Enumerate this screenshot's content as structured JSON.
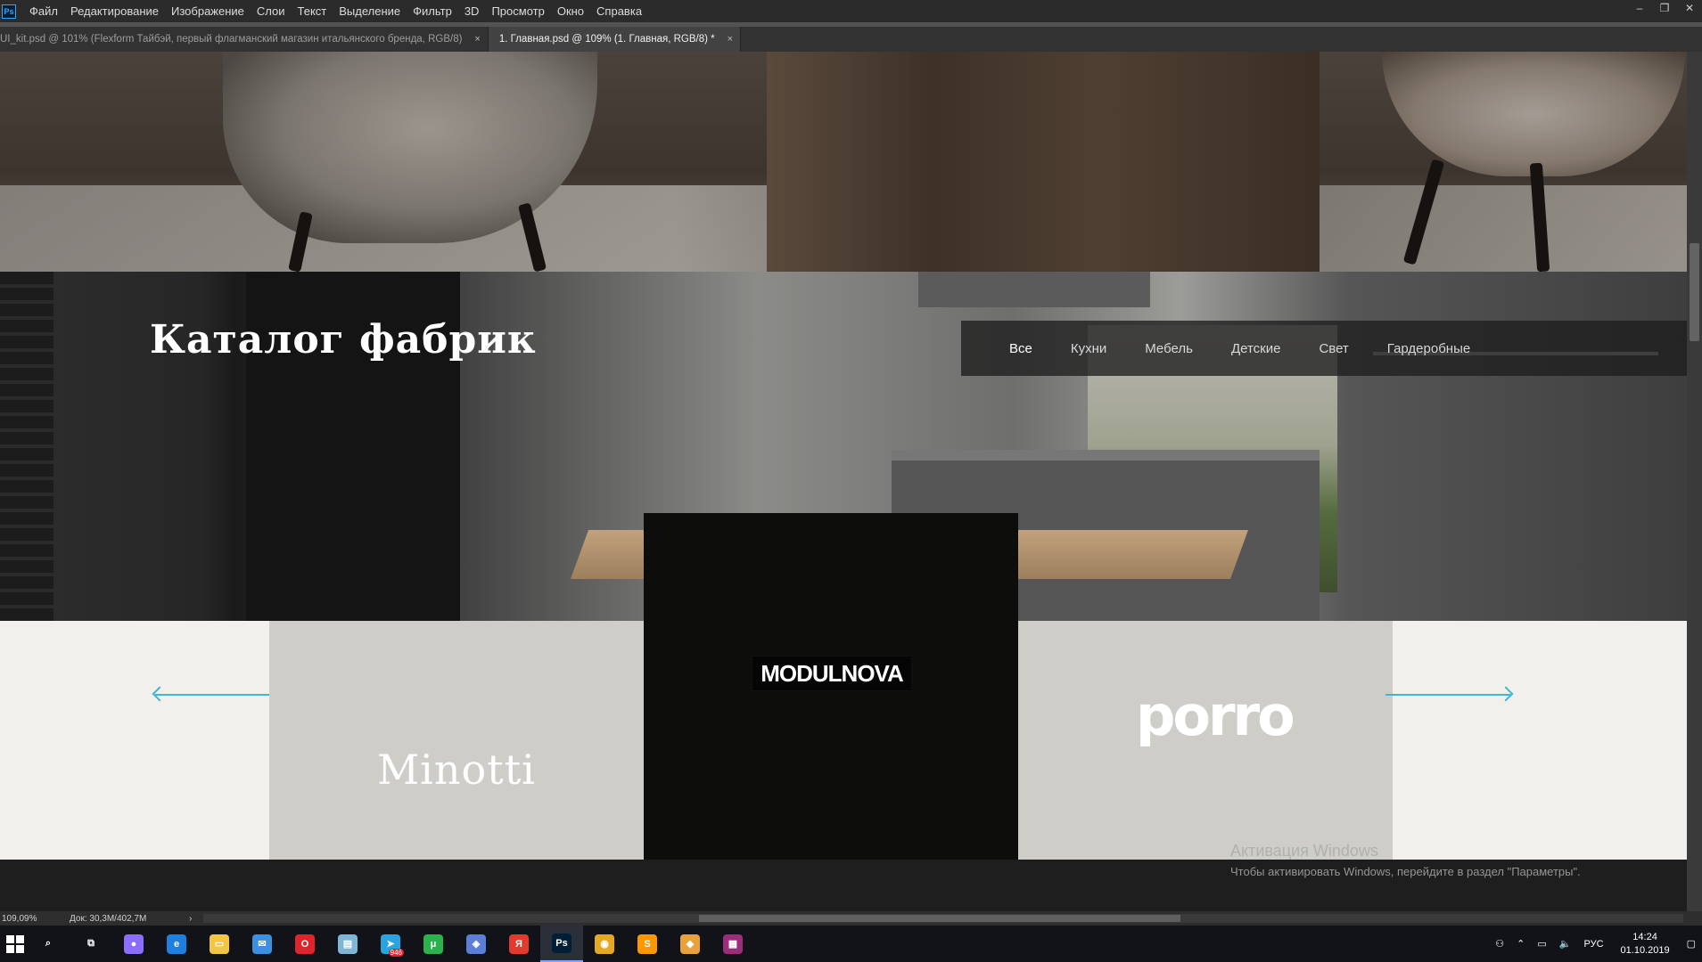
{
  "app": {
    "logo": "Ps"
  },
  "menu": [
    "Файл",
    "Редактирование",
    "Изображение",
    "Слои",
    "Текст",
    "Выделение",
    "Фильтр",
    "3D",
    "Просмотр",
    "Окно",
    "Справка"
  ],
  "window_controls": {
    "minimize": "–",
    "restore": "❐",
    "close": "✕"
  },
  "tabs": [
    {
      "label": "UI_kit.psd @ 101% (Flexform Тайбэй, первый флагманский магазин итальянского бренда, RGB/8)",
      "close": "×"
    },
    {
      "label": "1. Главная.psd @ 109% (1. Главная, RGB/8) *",
      "close": "×"
    }
  ],
  "page": {
    "heading": "Каталог фабрик",
    "filters": [
      "Все",
      "Кухни",
      "Мебель",
      "Детские",
      "Свет",
      "Гардеробные"
    ],
    "brands": {
      "minotti": "Minotti",
      "modulnova": "MODULNOVA",
      "porro": "porro"
    }
  },
  "watermark": {
    "title": "Активация Windows",
    "subtitle": "Чтобы активировать Windows, перейдите в раздел \"Параметры\"."
  },
  "status": {
    "zoom": "109,09%",
    "doc": "Док: 30,3M/402,7M",
    "arrow_right": "›",
    "arrow_left": "‹"
  },
  "taskbar": {
    "apps": [
      {
        "name": "search-icon",
        "glyph": "⌕"
      },
      {
        "name": "task-view-icon",
        "glyph": "⧉"
      },
      {
        "name": "alice-icon",
        "glyph": "●",
        "color": "#8b6dff"
      },
      {
        "name": "edge-icon",
        "glyph": "e",
        "color": "#1f7fe0"
      },
      {
        "name": "explorer-icon",
        "glyph": "▭",
        "color": "#f4c542"
      },
      {
        "name": "mail-icon",
        "glyph": "✉",
        "color": "#3d8fe0"
      },
      {
        "name": "opera-icon",
        "glyph": "O",
        "color": "#e0242c"
      },
      {
        "name": "notes-icon",
        "glyph": "▤",
        "color": "#7fb6d6"
      },
      {
        "name": "telegram-icon",
        "glyph": "➤",
        "color": "#2aa3e0",
        "badge": "946"
      },
      {
        "name": "torrent-icon",
        "glyph": "μ",
        "color": "#2bb24c"
      },
      {
        "name": "network-app-icon",
        "glyph": "◈",
        "color": "#5b7fd6"
      },
      {
        "name": "yandex-browser-icon",
        "glyph": "Я",
        "color": "#e23b2e"
      },
      {
        "name": "photoshop-icon",
        "glyph": "Ps",
        "color": "#001e36",
        "active": true
      },
      {
        "name": "chrome-icon",
        "glyph": "◉",
        "color": "#e5a823"
      },
      {
        "name": "sublime-icon",
        "glyph": "S",
        "color": "#ff9800"
      },
      {
        "name": "git-icon",
        "glyph": "◆",
        "color": "#e9a23b"
      },
      {
        "name": "winrar-icon",
        "glyph": "▦",
        "color": "#9b2d7a"
      }
    ],
    "tray": {
      "lang": "РУС",
      "time": "14:24",
      "date": "01.10.2019"
    }
  },
  "colors": {
    "accent_arrow": "#3fb6d3",
    "ps_blue": "#31a8ff"
  }
}
